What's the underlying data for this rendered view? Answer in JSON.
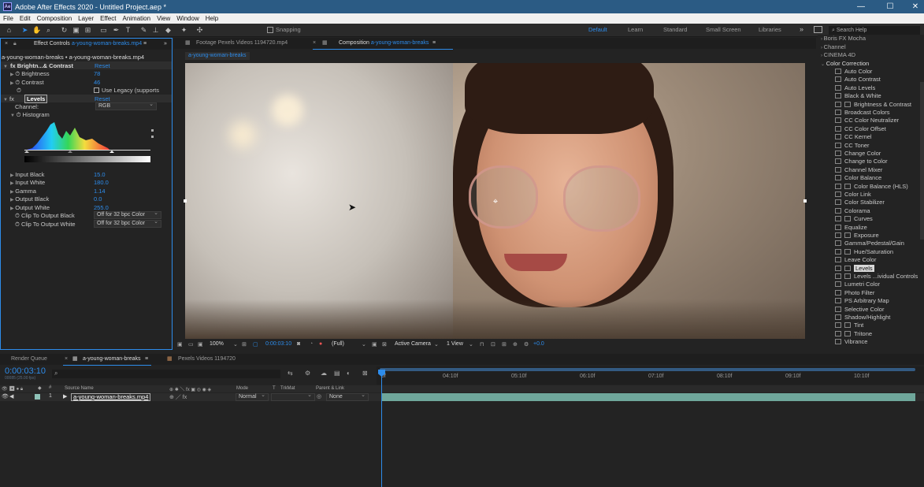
{
  "window": {
    "title": "Adobe After Effects 2020 - Untitled Project.aep *",
    "app_icon": "Ae"
  },
  "menu": [
    "File",
    "Edit",
    "Composition",
    "Layer",
    "Effect",
    "Animation",
    "View",
    "Window",
    "Help"
  ],
  "toolbar": {
    "snapping_label": "Snapping",
    "workspaces": [
      "Default",
      "Learn",
      "Standard",
      "Small Screen",
      "Libraries"
    ],
    "search_placeholder": "Search Help"
  },
  "effect_controls": {
    "tab_label": "Effect Controls",
    "tab_layer": "a-young-woman-breaks.mp4",
    "header": "a-young-woman-breaks • a-young-woman-breaks.mp4",
    "bc_name": "Brightn...& Contrast",
    "reset": "Reset",
    "brightness_label": "Brightness",
    "brightness_value": "78",
    "contrast_label": "Contrast",
    "contrast_value": "46",
    "legacy_label": "Use Legacy (supports",
    "levels_name": "Levels",
    "channel_label": "Channel:",
    "channel_value": "RGB",
    "histogram_label": "Histogram",
    "input_black_label": "Input Black",
    "input_black_value": "15.0",
    "input_white_label": "Input White",
    "input_white_value": "180.0",
    "gamma_label": "Gamma",
    "gamma_value": "1.14",
    "output_black_label": "Output Black",
    "output_black_value": "0.0",
    "output_white_label": "Output White",
    "output_white_value": "255.0",
    "clip_black_label": "Clip To Output Black",
    "clip_black_value": "Off for 32 bpc Color",
    "clip_white_label": "Clip To Output White",
    "clip_white_value": "Off for 32 bpc Color"
  },
  "viewer": {
    "footage_tab": "Footage Pexels Videos 1194720.mp4",
    "comp_tab_prefix": "Composition",
    "comp_tab_name": "a-young-woman-breaks",
    "comp_chip": "a-young-woman-breaks",
    "zoom": "100%",
    "timecode": "0:00:03:10",
    "resolution": "(Full)",
    "camera": "Active Camera",
    "views": "1 View",
    "exposure": "+0.0"
  },
  "effects_panel": {
    "groups": [
      "Boris FX Mocha",
      "Channel",
      "CINEMA 4D",
      "Color Correction"
    ],
    "items": [
      "Auto Color",
      "Auto Contrast",
      "Auto Levels",
      "Black & White",
      "Brightness & Contrast",
      "Broadcast Colors",
      "CC Color Neutralizer",
      "CC Color Offset",
      "CC Kernel",
      "CC Toner",
      "Change Color",
      "Change to Color",
      "Channel Mixer",
      "Color Balance",
      "Color Balance (HLS)",
      "Color Link",
      "Color Stabilizer",
      "Colorama",
      "Curves",
      "Equalize",
      "Exposure",
      "Gamma/Pedestal/Gain",
      "Hue/Saturation",
      "Leave Color",
      "Levels",
      "Levels ...ividual Controls",
      "Lumetri Color",
      "Photo Filter",
      "PS Arbitrary Map",
      "Selective Color",
      "Shadow/Highlight",
      "Tint",
      "Tritone",
      "Vibrance"
    ],
    "selected": "Levels"
  },
  "timeline": {
    "render_queue_tab": "Render Queue",
    "comp_tab": "a-young-woman-breaks",
    "footage_tab": "Pexels Videos 1194720",
    "timecode": "0:00:03:10",
    "timecode_sub": "00085 (25.00 fps)",
    "col_source": "Source Name",
    "col_mode": "Mode",
    "col_t": "T",
    "col_trkmat": "TrkMat",
    "col_parent": "Parent & Link",
    "layer_index": "1",
    "layer_name": "a-young-woman-breaks.mp4",
    "layer_mode": "Normal",
    "layer_parent": "None",
    "ruler": [
      "0f",
      "04:10f",
      "05:10f",
      "06:10f",
      "07:10f",
      "08:10f",
      "09:10f",
      "10:10f"
    ]
  }
}
